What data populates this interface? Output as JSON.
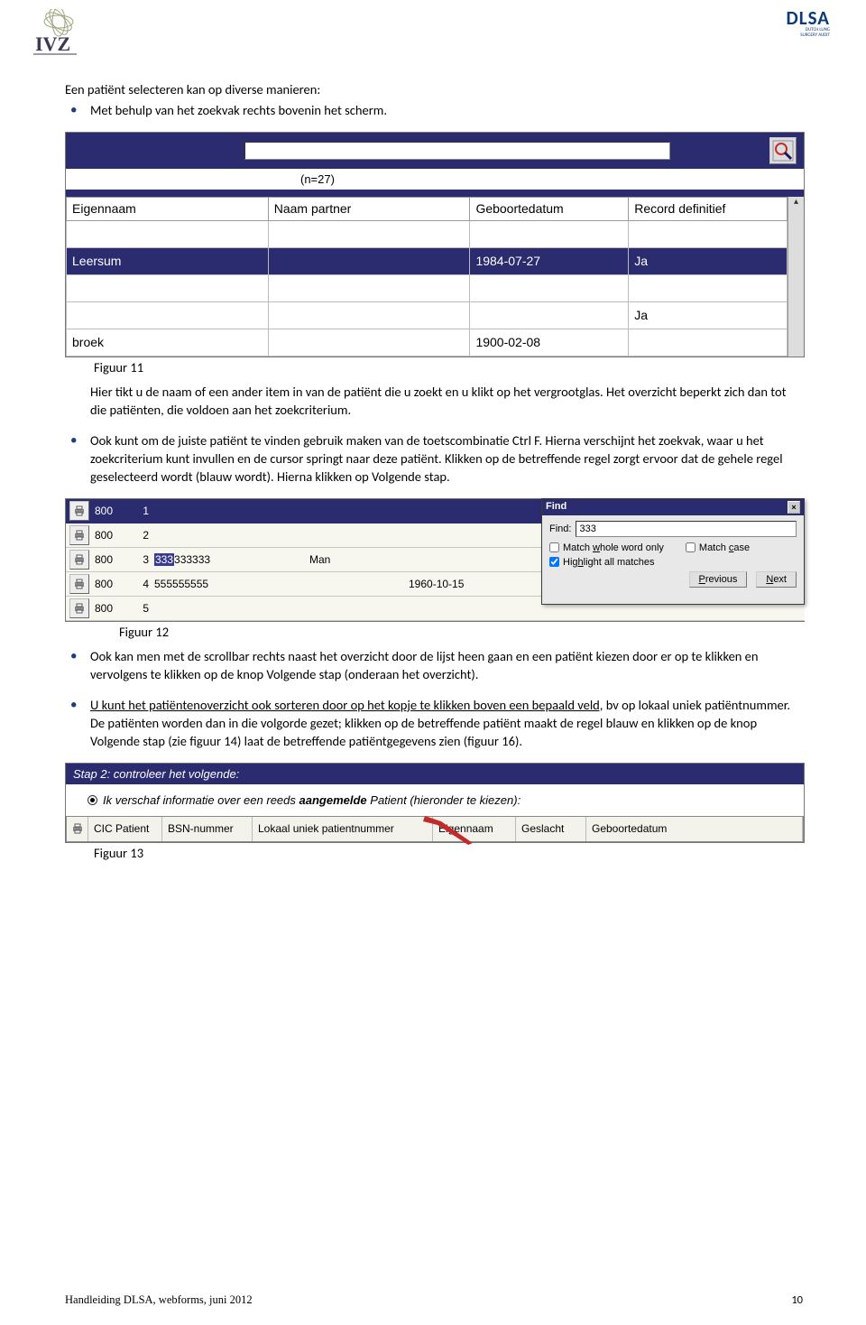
{
  "header": {
    "logo_left_alt": "IVZ",
    "logo_right_main": "DLSA",
    "logo_right_sub1": "DUTCH LUNG",
    "logo_right_sub2": "SURGERY AUDIT"
  },
  "intro": {
    "line": "Een patiënt selecteren kan op diverse manieren:",
    "b1": "Met behulp van het zoekvak rechts bovenin het scherm."
  },
  "fig11": {
    "n_count": "(n=27)",
    "headers": [
      "Eigennaam",
      "Naam partner",
      "Geboortedatum",
      "Record definitief"
    ],
    "rows": [
      {
        "c0": "Leersum",
        "c1": "",
        "c2": "1984-07-27",
        "c3": "Ja",
        "selected": true
      },
      {
        "c0": "",
        "c1": "",
        "c2": "",
        "c3": "",
        "selected": false
      },
      {
        "c0": "",
        "c1": "",
        "c2": "",
        "c3": "Ja",
        "selected": false
      },
      {
        "c0": "broek",
        "c1": "",
        "c2": "1900-02-08",
        "c3": "",
        "selected": false
      }
    ],
    "caption": "Figuur 11"
  },
  "para_after_11": "Hier tikt u de naam of een ander item in van de patiënt die u zoekt en u klikt op het vergrootglas. Het overzicht beperkt zich dan tot die patiënten, die voldoen aan het zoekcriterium.",
  "b2": "Ook kunt om de juiste patiënt te vinden gebruik maken van de toetscombinatie Ctrl F. Hierna verschijnt het zoekvak, waar u het zoekcriterium kunt invullen en de cursor springt naar deze patiënt. Klikken op de betreffende regel zorgt ervoor dat de gehele regel geselecteerd wordt (blauw wordt). Hierna klikken op Volgende stap.",
  "fig12": {
    "rows": [
      {
        "cic": "800",
        "n": "1",
        "bsn": "",
        "gender": "",
        "date": "",
        "dark": true
      },
      {
        "cic": "800",
        "n": "2",
        "bsn": "",
        "gender": "",
        "date": "",
        "dark": false
      },
      {
        "cic": "800",
        "n": "3",
        "bsn_hl": "333",
        "bsn_rest": "333333",
        "gender": "Man",
        "date": "",
        "dark": false
      },
      {
        "cic": "800",
        "n": "4",
        "bsn": "555555555",
        "gender": "",
        "date": "1960-10-15",
        "dark": false
      },
      {
        "cic": "800",
        "n": "5",
        "bsn": "",
        "gender": "",
        "date": "",
        "dark": false
      }
    ],
    "find": {
      "title": "Find",
      "label_find": "Find:",
      "value": "333",
      "chk_whole_pre": "Match ",
      "chk_whole_u": "w",
      "chk_whole_post": "hole word only",
      "chk_case_pre": "Match ",
      "chk_case_u": "c",
      "chk_case_post": "ase",
      "chk_hl_pre": "Hig",
      "chk_hl_u": "h",
      "chk_hl_post": "light all matches",
      "btn_prev_u": "P",
      "btn_prev_rest": "revious",
      "btn_next_u": "N",
      "btn_next_rest": "ext",
      "close": "×"
    },
    "caption": "Figuur 12"
  },
  "b3": "Ook kan men met de scrollbar rechts naast het overzicht door de lijst heen gaan en een patiënt kiezen door er op te klikken en vervolgens te klikken op de knop Volgende stap (onderaan het overzicht).",
  "b4_pre": "U kunt het patiëntenoverzicht ook sorteren door op het kopje te klikken boven een bepaald veld,",
  "b4_rest": " bv op lokaal uniek patiëntnummer. De patiënten worden dan in die volgorde gezet; klikken op de betreffende patiënt maakt de regel blauw en klikken op de knop Volgende stap (zie figuur 14) laat de betreffende patiëntgegevens zien (figuur 16).",
  "fig13": {
    "step": "Stap 2: controleer het volgende:",
    "radio_pre": "Ik verschaf informatie over een reeds ",
    "radio_bold": "aangemelde",
    "radio_post": " Patient (hieronder te kiezen):",
    "cols": [
      "CIC Patient",
      "BSN-nummer",
      "Lokaal uniek patientnummer",
      "Eigennaam",
      "Geslacht",
      "Geboortedatum"
    ],
    "caption": "Figuur 13"
  },
  "footer": {
    "left": "Handleiding DLSA, webforms, juni 2012",
    "right": "10"
  }
}
